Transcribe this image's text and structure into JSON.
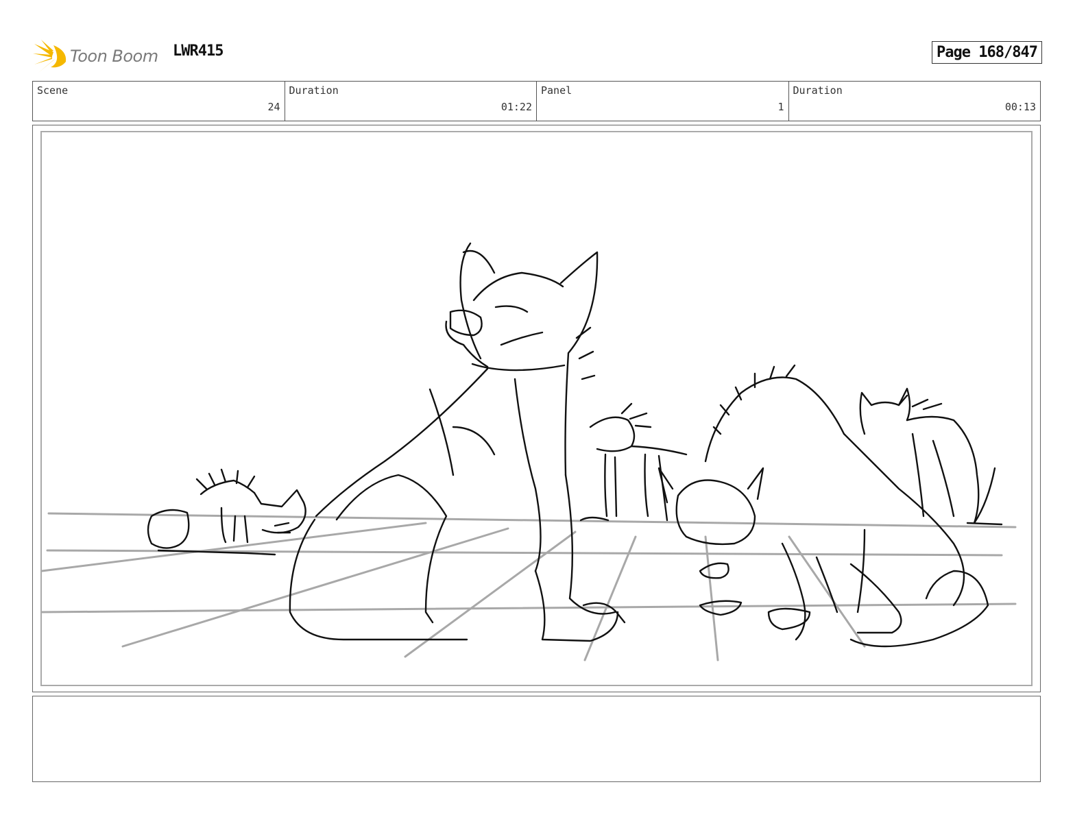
{
  "header": {
    "logo_text": "Toon Boom",
    "project_code": "LWR415",
    "page_label": "Page 168/847"
  },
  "info": {
    "scene_label": "Scene",
    "scene_value": "24",
    "scene_duration_label": "Duration",
    "scene_duration_value": "01:22",
    "panel_label": "Panel",
    "panel_value": "1",
    "panel_duration_label": "Duration",
    "panel_duration_value": "00:13"
  },
  "colors": {
    "logo_accent": "#f5b800",
    "sketch_line": "#111111",
    "guide_line": "#a8a8a8"
  },
  "notes": ""
}
